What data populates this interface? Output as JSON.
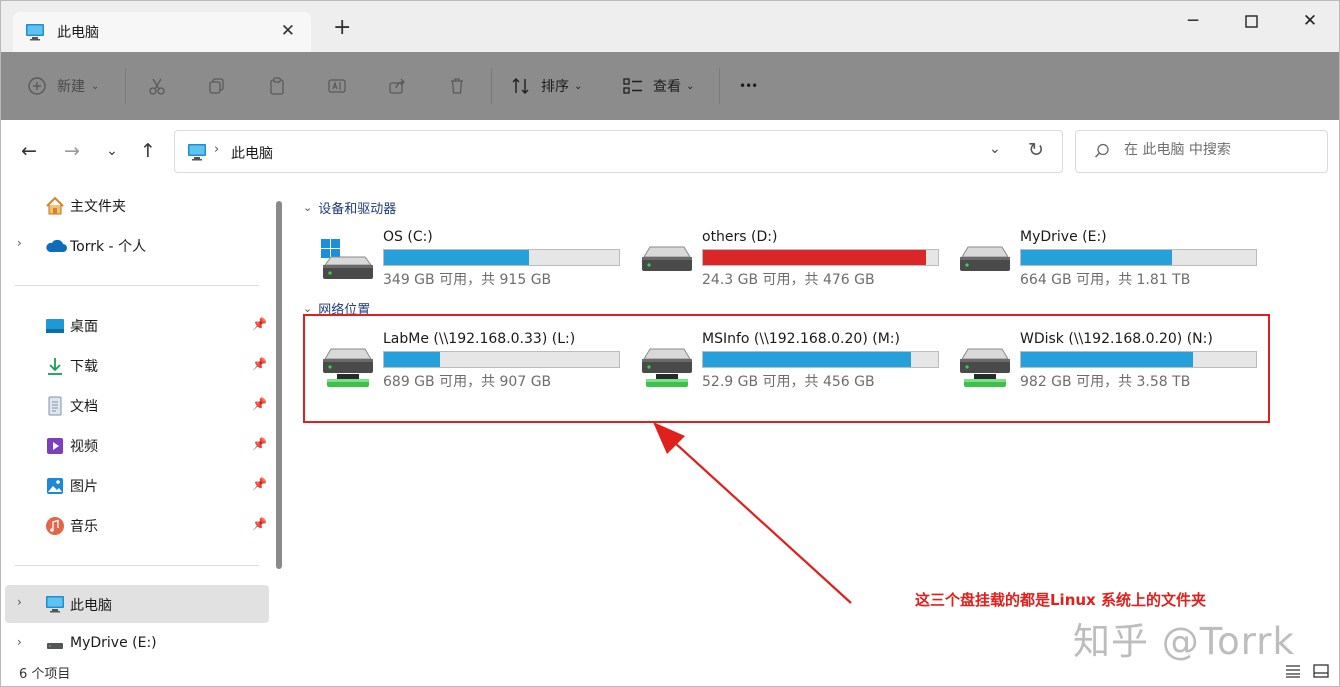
{
  "tab": {
    "title": "此电脑"
  },
  "toolbar": {
    "new_label": "新建",
    "sort_label": "排序",
    "view_label": "查看",
    "more_label": "•••"
  },
  "address": {
    "path": "此电脑"
  },
  "search": {
    "placeholder": "在 此电脑 中搜索"
  },
  "sidebar": {
    "items": [
      {
        "label": "主文件夹"
      },
      {
        "label": "Torrk - 个人"
      },
      {
        "label": "桌面"
      },
      {
        "label": "下载"
      },
      {
        "label": "文档"
      },
      {
        "label": "视频"
      },
      {
        "label": "图片"
      },
      {
        "label": "音乐"
      },
      {
        "label": "此电脑"
      },
      {
        "label": "MyDrive (E:)"
      }
    ]
  },
  "sections": {
    "devices": "设备和驱动器",
    "network": "网络位置"
  },
  "drives": [
    {
      "name": "OS (C:)",
      "size": "349 GB 可用，共 915 GB",
      "used": 0.619,
      "color": "#26a0da"
    },
    {
      "name": "others (D:)",
      "size": "24.3 GB 可用，共 476 GB",
      "used": 0.949,
      "color": "#da2626"
    },
    {
      "name": "MyDrive (E:)",
      "size": "664 GB 可用，共 1.81 TB",
      "used": 0.642,
      "color": "#26a0da"
    },
    {
      "name": "LabMe (\\\\192.168.0.33) (L:)",
      "size": "689 GB 可用，共 907 GB",
      "used": 0.24,
      "color": "#26a0da"
    },
    {
      "name": "MSInfo (\\\\192.168.0.20) (M:)",
      "size": "52.9 GB 可用，共 456 GB",
      "used": 0.884,
      "color": "#26a0da"
    },
    {
      "name": "WDisk (\\\\192.168.0.20) (N:)",
      "size": "982 GB 可用，共 3.58 TB",
      "used": 0.732,
      "color": "#26a0da"
    }
  ],
  "annotation": "这三个盘挂载的都是Linux 系统上的文件夹",
  "watermark": "知乎 @Torrk",
  "status": {
    "count": "6 个项目"
  }
}
